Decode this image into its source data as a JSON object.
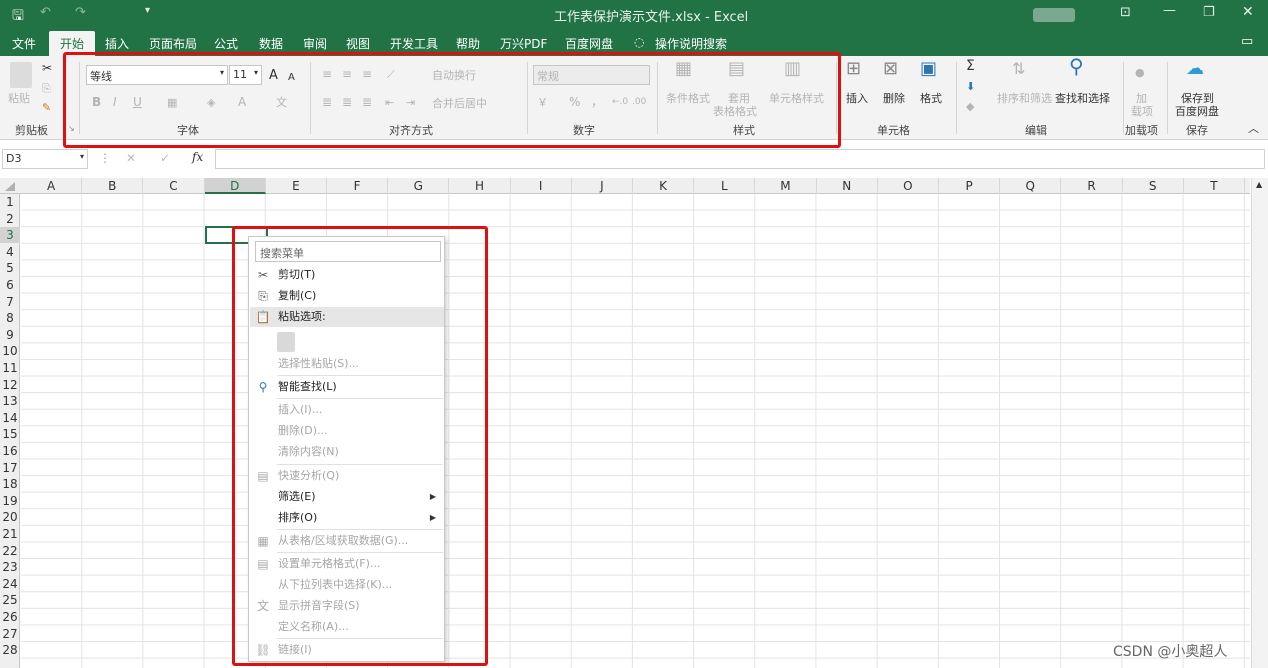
{
  "window": {
    "title": "工作表保护演示文件.xlsx - Excel",
    "icons": [
      "save-icon",
      "undo-icon",
      "redo-icon",
      "customize-qat-icon",
      "ribbon-display-icon",
      "minimize-icon",
      "restore-icon",
      "close-icon"
    ]
  },
  "tabs": [
    "文件",
    "开始",
    "插入",
    "页面布局",
    "公式",
    "数据",
    "审阅",
    "视图",
    "开发工具",
    "帮助",
    "万兴PDF",
    "百度网盘",
    "操作说明搜索"
  ],
  "active_tab": "开始",
  "ribbon": {
    "clipboard": {
      "paste": "粘贴",
      "label": "剪贴板"
    },
    "font": {
      "name": "等线",
      "size": "11",
      "label": "字体",
      "bold": "B",
      "italic": "I",
      "underline": "U",
      "grow": "A",
      "shrink": "A",
      "font_color": "A"
    },
    "align": {
      "wrap": "自动换行",
      "merge": "合并后居中",
      "label": "对齐方式"
    },
    "number": {
      "format": "常规",
      "percent": "%",
      "comma": "，",
      "label": "数字"
    },
    "styles": {
      "cond": "条件格式",
      "table1": "套用",
      "table2": "表格格式",
      "cell": "单元格样式",
      "label": "样式"
    },
    "cells": {
      "insert": "插入",
      "delete": "删除",
      "format": "格式",
      "label": "单元格"
    },
    "edit": {
      "sum": "Σ",
      "sort": "排序和筛选",
      "find": "查找和选择",
      "label": "编辑"
    },
    "addins": {
      "top": "加",
      "bottom": "载项",
      "label": "加载项"
    },
    "save": {
      "top": "保存到",
      "bottom": "百度网盘",
      "label": "保存"
    }
  },
  "formula_bar": {
    "name_box": "D3",
    "fx": "fx",
    "cancel": "✕",
    "enter": "✓",
    "value": ""
  },
  "columns": [
    "A",
    "B",
    "C",
    "D",
    "E",
    "F",
    "G",
    "H",
    "I",
    "J",
    "K",
    "L",
    "M",
    "N",
    "O",
    "P",
    "Q",
    "R",
    "S",
    "T"
  ],
  "rows": [
    "1",
    "2",
    "3",
    "4",
    "5",
    "6",
    "7",
    "8",
    "9",
    "10",
    "11",
    "12",
    "13",
    "14",
    "15",
    "16",
    "17",
    "18",
    "19",
    "20",
    "21",
    "22",
    "23",
    "24",
    "25",
    "26",
    "27",
    "28"
  ],
  "context_menu": {
    "search_placeholder": "搜索菜单",
    "items": [
      {
        "label": "剪切(T)",
        "enabled": true,
        "icon": "scissors-icon"
      },
      {
        "label": "复制(C)",
        "enabled": true,
        "icon": "copy-icon"
      },
      {
        "label": "粘贴选项:",
        "enabled": true,
        "icon": "paste-icon",
        "header": true
      },
      {
        "label": "选择性粘贴(S)...",
        "enabled": false
      },
      {
        "label": "智能查找(L)",
        "enabled": true,
        "icon": "smart-lookup-icon"
      },
      {
        "label": "插入(I)...",
        "enabled": false
      },
      {
        "label": "删除(D)...",
        "enabled": false
      },
      {
        "label": "清除内容(N)",
        "enabled": false
      },
      {
        "label": "快速分析(Q)",
        "enabled": false,
        "icon": "quick-analysis-icon"
      },
      {
        "label": "筛选(E)",
        "enabled": true,
        "submenu": true
      },
      {
        "label": "排序(O)",
        "enabled": true,
        "submenu": true
      },
      {
        "label": "从表格/区域获取数据(G)...",
        "enabled": false,
        "icon": "table-icon"
      },
      {
        "label": "设置单元格格式(F)...",
        "enabled": false,
        "icon": "format-cells-icon"
      },
      {
        "label": "从下拉列表中选择(K)...",
        "enabled": false
      },
      {
        "label": "显示拼音字段(S)",
        "enabled": false,
        "icon": "phonetic-icon"
      },
      {
        "label": "定义名称(A)...",
        "enabled": false
      },
      {
        "label": "链接(I)",
        "enabled": false,
        "icon": "link-icon"
      }
    ]
  },
  "watermark": "CSDN @小奥超人",
  "highlight_color": "#e01010",
  "accent_color": "#217346"
}
